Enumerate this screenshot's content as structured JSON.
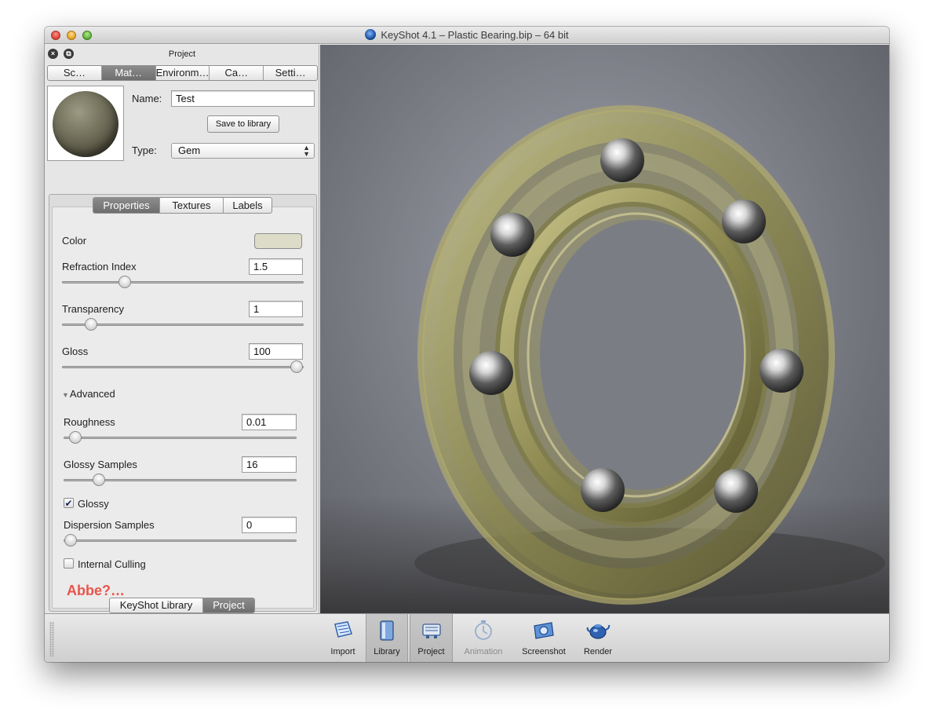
{
  "window": {
    "title": "KeyShot 4.1  – Plastic Bearing.bip  – 64 bit"
  },
  "panel": {
    "title": "Project",
    "tabs": [
      "Sc…",
      "Mat…",
      "Environm…",
      "Ca…",
      "Setti…"
    ],
    "active_tab": 1,
    "name_label": "Name:",
    "name_value": "Test",
    "save_button": "Save to library",
    "type_label": "Type:",
    "type_value": "Gem"
  },
  "subtabs": {
    "items": [
      "Properties",
      "Textures",
      "Labels"
    ],
    "active": 0
  },
  "properties": {
    "color_label": "Color",
    "color_value": "#dcdcc8",
    "refraction_label": "Refraction Index",
    "refraction_value": "1.5",
    "refraction_fraction": 0.26,
    "transparency_label": "Transparency",
    "transparency_value": "1",
    "transparency_fraction": 0.12,
    "gloss_label": "Gloss",
    "gloss_value": "100",
    "gloss_fraction": 0.97,
    "advanced_label": "Advanced",
    "roughness_label": "Roughness",
    "roughness_value": "0.01",
    "roughness_fraction": 0.05,
    "glossy_samples_label": "Glossy Samples",
    "glossy_samples_value": "16",
    "glossy_samples_fraction": 0.15,
    "glossy_label": "Glossy",
    "glossy_checked": true,
    "dispersion_label": "Dispersion Samples",
    "dispersion_value": "0",
    "dispersion_fraction": 0.03,
    "internal_culling_label": "Internal Culling",
    "internal_culling_checked": false,
    "annotation": "Abbe?…",
    "annotation_color": "#e8554b"
  },
  "library_switch": {
    "items": [
      "KeyShot Library",
      "Project"
    ],
    "active": 1
  },
  "toolbar": {
    "items": [
      {
        "label": "Import",
        "icon": "import-icon",
        "active": false,
        "disabled": false
      },
      {
        "label": "Library",
        "icon": "library-icon",
        "active": true,
        "disabled": false
      },
      {
        "label": "Project",
        "icon": "project-icon",
        "active": true,
        "disabled": false
      },
      {
        "label": "Animation",
        "icon": "animation-icon",
        "active": false,
        "disabled": true
      },
      {
        "label": "Screenshot",
        "icon": "screenshot-icon",
        "active": false,
        "disabled": false
      },
      {
        "label": "Render",
        "icon": "render-icon",
        "active": false,
        "disabled": false
      }
    ]
  }
}
